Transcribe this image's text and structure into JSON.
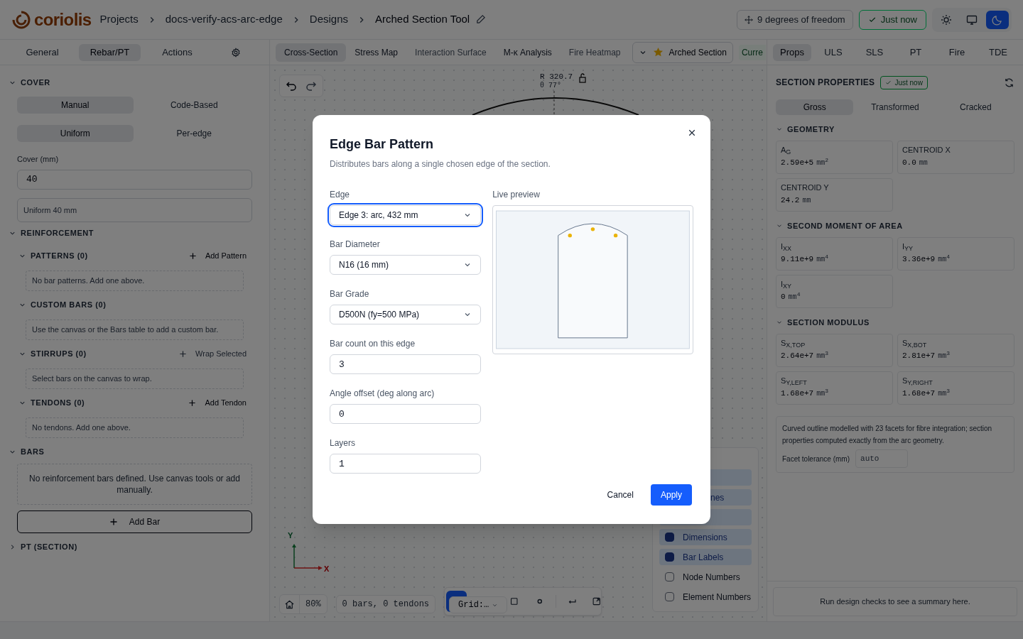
{
  "header": {
    "logo": "coriolis",
    "breadcrumbs": [
      {
        "label": "Projects",
        "current": false
      },
      {
        "label": "docs-verify-acs-arc-edge",
        "current": false
      },
      {
        "label": "Designs",
        "current": false
      },
      {
        "label": "Arched Section Tool",
        "current": true
      }
    ],
    "dof": "9 degrees of freedom",
    "save_status": "Just now",
    "theme_modes": [
      {
        "kind": "light",
        "selected": false
      },
      {
        "kind": "system",
        "selected": false
      },
      {
        "kind": "dark",
        "selected": true
      }
    ]
  },
  "left_tabs": [
    {
      "label": "General",
      "selected": false
    },
    {
      "label": "Rebar/PT",
      "selected": true
    },
    {
      "label": "Actions",
      "selected": false
    }
  ],
  "center_tabs": [
    {
      "label": "Cross-Section",
      "selected": true,
      "disabled": false
    },
    {
      "label": "Stress Map",
      "selected": false,
      "disabled": false
    },
    {
      "label": "Interaction Surface",
      "selected": false,
      "disabled": true
    },
    {
      "label": "M-κ Analysis",
      "selected": false,
      "disabled": false
    },
    {
      "label": "Fire Heatmap",
      "selected": false,
      "disabled": true
    }
  ],
  "preset": {
    "label": "Arched Section",
    "starred": true
  },
  "preset_badge": "Curre",
  "right_tabs": [
    {
      "label": "Props",
      "selected": true
    },
    {
      "label": "ULS",
      "selected": false
    },
    {
      "label": "SLS",
      "selected": false
    },
    {
      "label": "PT",
      "selected": false
    },
    {
      "label": "Fire",
      "selected": false
    },
    {
      "label": "TDE",
      "selected": false
    }
  ],
  "left_panel": {
    "cover": {
      "title": "COVER",
      "expanded": true,
      "mode": [
        {
          "label": "Manual",
          "selected": true
        },
        {
          "label": "Code-Based",
          "selected": false
        }
      ],
      "distribution": [
        {
          "label": "Uniform",
          "selected": true
        },
        {
          "label": "Per-edge",
          "selected": false
        }
      ],
      "field_label": "Cover (mm)",
      "value": "40",
      "summary": "Uniform 40 mm"
    },
    "reinforcement": {
      "title": "REINFORCEMENT",
      "expanded": true,
      "groups": [
        {
          "title": "PATTERNS (0)",
          "expanded": true,
          "action": "Add Pattern",
          "action_disabled": false,
          "empty": "No bar patterns. Add one above."
        },
        {
          "title": "CUSTOM BARS (0)",
          "expanded": true,
          "empty": "Use the canvas or the Bars table to add a custom bar."
        },
        {
          "title": "STIRRUPS (0)",
          "expanded": true,
          "action": "Wrap Selected",
          "action_disabled": true,
          "empty": "Select bars on the canvas to wrap."
        },
        {
          "title": "TENDONS (0)",
          "expanded": true,
          "action": "Add Tendon",
          "action_disabled": false,
          "empty": "No tendons. Add one above."
        }
      ]
    },
    "bars": {
      "title": "BARS",
      "expanded": true,
      "empty": "No reinforcement bars defined. Use canvas tools or add manually.",
      "button": "Add Bar"
    },
    "pt": {
      "title": "PT (SECTION)",
      "expanded": false
    }
  },
  "canvas": {
    "radius_label": "R 320.7",
    "angle_label": "θ 77°",
    "axis_y": "Y",
    "axis_x": "X",
    "zoom": "80%",
    "counts": "0 bars, 0 tendons",
    "grid": "Grid:…",
    "layers": [
      {
        "kind": "partial",
        "checked": true
      },
      {
        "kind": "partial",
        "checked": true,
        "label": "nes"
      },
      {
        "kind": "partial",
        "checked": true
      },
      {
        "kind": "full",
        "label": "Dimensions",
        "checked": true
      },
      {
        "kind": "full",
        "label": "Bar Labels",
        "checked": true
      },
      {
        "kind": "full",
        "label": "Node Numbers",
        "checked": false
      },
      {
        "kind": "full",
        "label": "Element Numbers",
        "checked": false
      }
    ]
  },
  "right_panel": {
    "title": "SECTION PROPERTIES",
    "status": "Just now",
    "tabs": [
      {
        "label": "Gross",
        "selected": true
      },
      {
        "label": "Transformed",
        "selected": false
      },
      {
        "label": "Cracked",
        "selected": false
      }
    ],
    "groups": [
      {
        "title": "GEOMETRY",
        "items": [
          {
            "label": "A$_{G}$",
            "value": "2.59e+5",
            "unit": "mm$^{2}$"
          },
          {
            "label": "CENTROID X",
            "value": "0.0",
            "unit": "mm"
          },
          {
            "label": "CENTROID Y",
            "value": "24.2",
            "unit": "mm"
          }
        ]
      },
      {
        "title": "SECOND MOMENT OF AREA",
        "items": [
          {
            "label": "I$_{XX}$",
            "value": "9.11e+9",
            "unit": "mm$^{4}$"
          },
          {
            "label": "I$_{YY}$",
            "value": "3.36e+9",
            "unit": "mm$^{4}$"
          },
          {
            "label": "I$_{XY}$",
            "value": "0",
            "unit": "mm$^{4}$"
          }
        ]
      },
      {
        "title": "SECTION MODULUS",
        "items": [
          {
            "label": "S$_{X,TOP}$",
            "value": "2.64e+7",
            "unit": "mm$^{3}$"
          },
          {
            "label": "S$_{X,BOT}$",
            "value": "2.81e+7",
            "unit": "mm$^{3}$"
          },
          {
            "label": "S$_{Y,LEFT}$",
            "value": "1.68e+7",
            "unit": "mm$^{3}$"
          },
          {
            "label": "S$_{Y,RIGHT}$",
            "value": "1.68e+7",
            "unit": "mm$^{3}$"
          }
        ]
      }
    ],
    "note": "Curved outline modelled with 23 facets for fibre integration; section properties computed exactly from the arc geometry.",
    "tolerance_label": "Facet tolerance (mm)",
    "tolerance_placeholder": "auto",
    "summary": "Run design checks to see a summary here."
  },
  "dialog": {
    "title": "Edge Bar Pattern",
    "description": "Distributes bars along a single chosen edge of the section.",
    "fields": [
      {
        "label": "Edge",
        "kind": "select",
        "value": "Edge 3: arc, 432 mm",
        "focused": true
      },
      {
        "label": "Bar Diameter",
        "kind": "select",
        "value": "N16 (16 mm)",
        "focused": false
      },
      {
        "label": "Bar Grade",
        "kind": "select",
        "value": "D500N (fy=500 MPa)",
        "focused": false
      },
      {
        "label": "Bar count on this edge",
        "kind": "number",
        "value": "3",
        "focused": false
      },
      {
        "label": "Angle offset (deg along arc)",
        "kind": "number",
        "value": "0",
        "focused": false
      },
      {
        "label": "Layers",
        "kind": "number",
        "value": "1",
        "focused": false
      }
    ],
    "preview_label": "Live preview",
    "cancel": "Cancel",
    "apply": "Apply"
  }
}
